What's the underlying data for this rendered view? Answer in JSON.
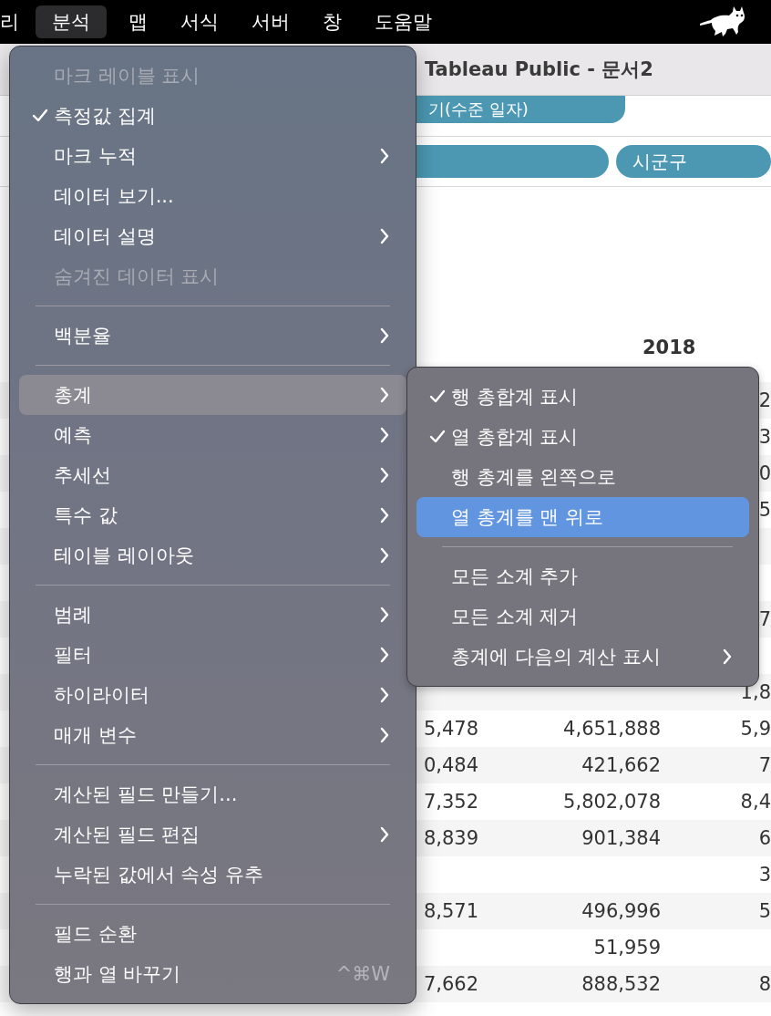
{
  "menubar": {
    "items": [
      {
        "label": "리",
        "selected": false
      },
      {
        "label": "분석",
        "selected": true
      },
      {
        "label": "맵",
        "selected": false
      },
      {
        "label": "서식",
        "selected": false
      },
      {
        "label": "서버",
        "selected": false
      },
      {
        "label": "창",
        "selected": false
      },
      {
        "label": "도움말",
        "selected": false
      }
    ]
  },
  "window": {
    "title": "Tableau Public - 문서2"
  },
  "shelves": [
    {
      "pills": [
        {
          "kind": "labeled",
          "label": "기(수준 일자)"
        }
      ]
    },
    {
      "pills": [
        {
          "kind": "blank"
        },
        {
          "kind": "labeled",
          "label": "시군구"
        }
      ]
    }
  ],
  "table": {
    "column_header": "2018",
    "rows": [
      {
        "cells": [
          null,
          null,
          "2"
        ]
      },
      {
        "cells": [
          null,
          null,
          "3"
        ]
      },
      {
        "cells": [
          null,
          null,
          "0"
        ]
      },
      {
        "cells": [
          null,
          null,
          "5"
        ]
      },
      {
        "cells": [
          null,
          null,
          null
        ]
      },
      {
        "cells": [
          null,
          null,
          null
        ]
      },
      {
        "cells": [
          null,
          null,
          "7"
        ]
      },
      {
        "cells": [
          null,
          null,
          null
        ]
      },
      {
        "cells": [
          null,
          null,
          "1,8"
        ]
      },
      {
        "cells": [
          "5,478",
          "4,651,888",
          "5,9"
        ]
      },
      {
        "cells": [
          "0,484",
          "421,662",
          "7"
        ]
      },
      {
        "cells": [
          "7,352",
          "5,802,078",
          "8,4"
        ]
      },
      {
        "cells": [
          "8,839",
          "901,384",
          "6"
        ]
      },
      {
        "cells": [
          null,
          null,
          "3"
        ]
      },
      {
        "cells": [
          "8,571",
          "496,996",
          "5"
        ]
      },
      {
        "cells": [
          null,
          "51,959",
          null
        ]
      },
      {
        "cells": [
          "7,662",
          "888,532",
          "8"
        ]
      }
    ]
  },
  "menu": {
    "items": [
      {
        "kind": "item",
        "label": "마크 레이블 표시",
        "checked": false,
        "disabled": true,
        "submenu": false,
        "selected": false
      },
      {
        "kind": "item",
        "label": "측정값 집계",
        "checked": true,
        "disabled": false,
        "submenu": false,
        "selected": false
      },
      {
        "kind": "item",
        "label": "마크 누적",
        "checked": false,
        "disabled": false,
        "submenu": true,
        "selected": false
      },
      {
        "kind": "item",
        "label": "데이터 보기...",
        "checked": false,
        "disabled": false,
        "submenu": false,
        "selected": false
      },
      {
        "kind": "item",
        "label": "데이터 설명",
        "checked": false,
        "disabled": false,
        "submenu": true,
        "selected": false
      },
      {
        "kind": "item",
        "label": "숨겨진 데이터 표시",
        "checked": false,
        "disabled": true,
        "submenu": false,
        "selected": false
      },
      {
        "kind": "separator"
      },
      {
        "kind": "item",
        "label": "백분율",
        "checked": false,
        "disabled": false,
        "submenu": true,
        "selected": false
      },
      {
        "kind": "separator"
      },
      {
        "kind": "item",
        "label": "총계",
        "checked": false,
        "disabled": false,
        "submenu": true,
        "selected": true
      },
      {
        "kind": "item",
        "label": "예측",
        "checked": false,
        "disabled": false,
        "submenu": true,
        "selected": false
      },
      {
        "kind": "item",
        "label": "추세선",
        "checked": false,
        "disabled": false,
        "submenu": true,
        "selected": false
      },
      {
        "kind": "item",
        "label": "특수 값",
        "checked": false,
        "disabled": false,
        "submenu": true,
        "selected": false
      },
      {
        "kind": "item",
        "label": "테이블 레이아웃",
        "checked": false,
        "disabled": false,
        "submenu": true,
        "selected": false
      },
      {
        "kind": "separator"
      },
      {
        "kind": "item",
        "label": "범례",
        "checked": false,
        "disabled": false,
        "submenu": true,
        "selected": false
      },
      {
        "kind": "item",
        "label": "필터",
        "checked": false,
        "disabled": false,
        "submenu": true,
        "selected": false
      },
      {
        "kind": "item",
        "label": "하이라이터",
        "checked": false,
        "disabled": false,
        "submenu": true,
        "selected": false
      },
      {
        "kind": "item",
        "label": "매개 변수",
        "checked": false,
        "disabled": false,
        "submenu": true,
        "selected": false
      },
      {
        "kind": "separator"
      },
      {
        "kind": "item",
        "label": "계산된 필드 만들기...",
        "checked": false,
        "disabled": false,
        "submenu": false,
        "selected": false
      },
      {
        "kind": "item",
        "label": "계산된 필드 편집",
        "checked": false,
        "disabled": false,
        "submenu": true,
        "selected": false
      },
      {
        "kind": "item",
        "label": "누락된 값에서 속성 유추",
        "checked": false,
        "disabled": false,
        "submenu": false,
        "selected": false
      },
      {
        "kind": "separator"
      },
      {
        "kind": "item",
        "label": "필드 순환",
        "checked": false,
        "disabled": false,
        "submenu": false,
        "selected": false
      },
      {
        "kind": "item",
        "label": "행과 열 바꾸기",
        "checked": false,
        "disabled": false,
        "submenu": false,
        "selected": false,
        "shortcut": "^⌘W"
      }
    ]
  },
  "submenu": {
    "items": [
      {
        "kind": "item",
        "label": "행 총합계 표시",
        "checked": true,
        "disabled": false,
        "submenu": false,
        "selected": false
      },
      {
        "kind": "item",
        "label": "열 총합계 표시",
        "checked": true,
        "disabled": false,
        "submenu": false,
        "selected": false
      },
      {
        "kind": "item",
        "label": "행 총계를 왼쪽으로",
        "checked": false,
        "disabled": false,
        "submenu": false,
        "selected": false
      },
      {
        "kind": "item",
        "label": "열 총계를 맨 위로",
        "checked": false,
        "disabled": false,
        "submenu": false,
        "selected": true
      },
      {
        "kind": "separator"
      },
      {
        "kind": "item",
        "label": "모든 소계 추가",
        "checked": false,
        "disabled": false,
        "submenu": false,
        "selected": false
      },
      {
        "kind": "item",
        "label": "모든 소계 제거",
        "checked": false,
        "disabled": false,
        "submenu": false,
        "selected": false
      },
      {
        "kind": "item",
        "label": "총계에 다음의 계산 표시",
        "checked": false,
        "disabled": false,
        "submenu": true,
        "selected": false
      }
    ]
  }
}
